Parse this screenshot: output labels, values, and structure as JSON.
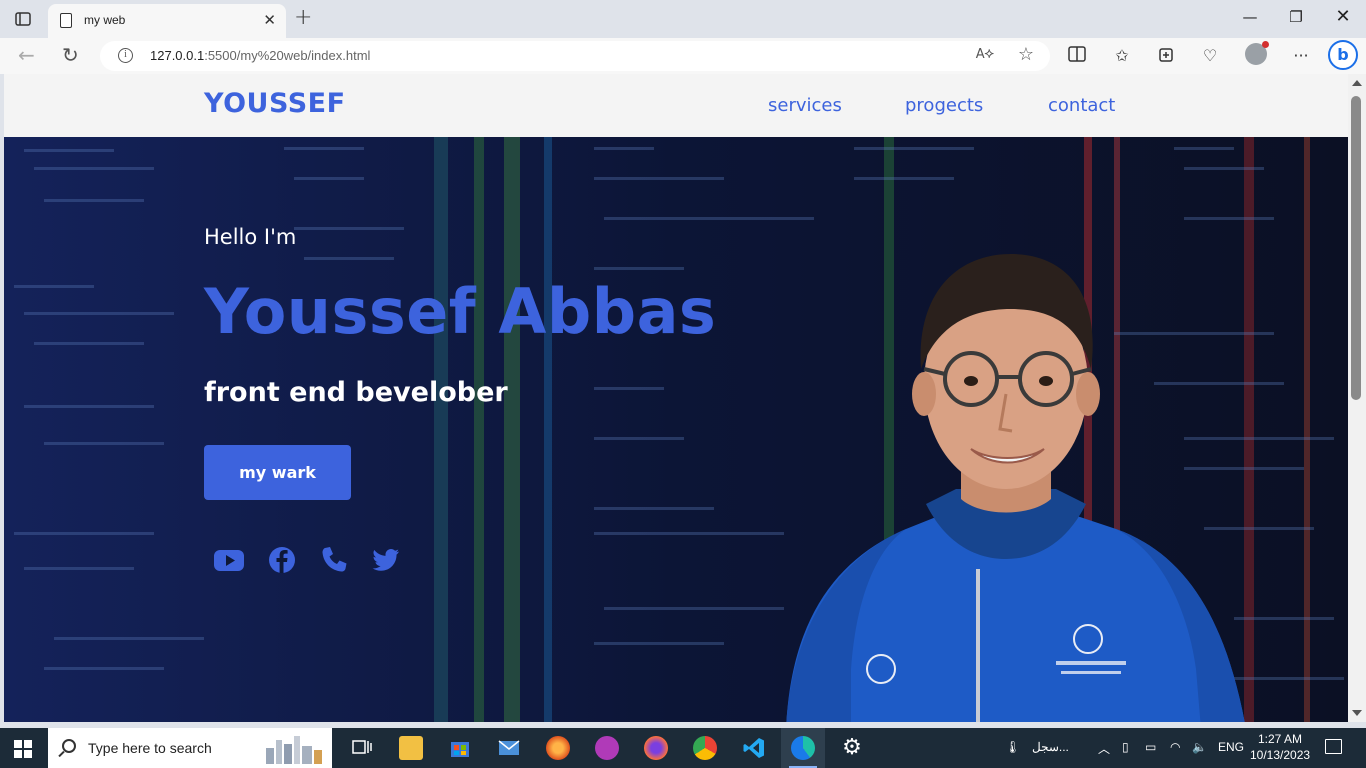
{
  "browser": {
    "tab_title": "my web",
    "url_host": "127.0.0.1",
    "url_rest": ":5500/my%20web/index.html"
  },
  "site": {
    "logo": "YOUSSEF",
    "nav": [
      "services",
      "progects",
      "contact"
    ],
    "hero": {
      "greeting": "Hello I'm",
      "name": "Youssef Abbas",
      "role": "front end bevelober",
      "cta_label": "my wark",
      "social_icons": [
        "youtube-icon",
        "facebook-icon",
        "phone-icon",
        "twitter-icon"
      ]
    },
    "colors": {
      "accent": "#3d63dd",
      "header_bg": "#f4f4f4"
    }
  },
  "taskbar": {
    "search_placeholder": "Type here to search",
    "weather_text": "سجل...",
    "language": "ENG",
    "time": "1:27 AM",
    "date": "10/13/2023"
  }
}
